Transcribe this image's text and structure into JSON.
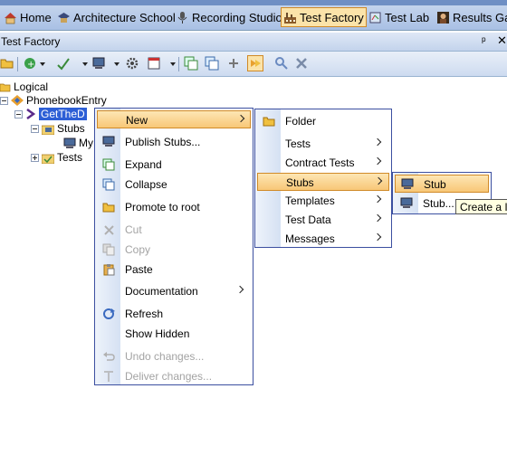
{
  "perspectives": [
    {
      "label": "Home",
      "icon": "house-icon"
    },
    {
      "label": "Architecture School",
      "icon": "graduation-cap-icon"
    },
    {
      "label": "Recording Studio",
      "icon": "microphone-icon"
    },
    {
      "label": "Test Factory",
      "icon": "factory-icon",
      "active": true
    },
    {
      "label": "Test Lab",
      "icon": "test-lab-icon"
    },
    {
      "label": "Results Ga",
      "icon": "results-gallery-icon"
    }
  ],
  "view": {
    "title": "Test Factory",
    "pin_glyph": "ᵖ",
    "close_glyph": "✕"
  },
  "tree": {
    "logical": "Logical",
    "phonebook": "PhonebookEntry",
    "selected": "GetTheD",
    "stubs": "Stubs",
    "my": "My",
    "tests": "Tests"
  },
  "context_menu": {
    "items": [
      {
        "label": "New",
        "icon": "",
        "submenu": true,
        "highlighted": true
      },
      {
        "label": "Publish Stubs...",
        "icon": "computer-icon"
      },
      {
        "label": "Expand",
        "icon": "expand-icon"
      },
      {
        "label": "Collapse",
        "icon": "collapse-icon"
      },
      {
        "label": "Promote to root",
        "icon": "folder-icon"
      },
      {
        "label": "Cut",
        "icon": "scissors-icon",
        "disabled": true
      },
      {
        "label": "Copy",
        "icon": "copy-icon",
        "disabled": true
      },
      {
        "label": "Paste",
        "icon": "paste-icon"
      },
      {
        "label": "Documentation",
        "icon": "",
        "submenu": true
      },
      {
        "label": "Refresh",
        "icon": "refresh-icon"
      },
      {
        "label": "Show Hidden",
        "icon": ""
      },
      {
        "label": "Undo changes...",
        "icon": "undo-icon",
        "disabled": true
      },
      {
        "label": "Deliver changes...",
        "icon": "deliver-icon",
        "disabled": true
      }
    ]
  },
  "new_menu": {
    "items": [
      {
        "label": "Folder",
        "icon": "folder-icon"
      },
      {
        "label": "Tests",
        "submenu": true
      },
      {
        "label": "Contract Tests",
        "submenu": true
      },
      {
        "label": "Stubs",
        "submenu": true,
        "highlighted": true
      },
      {
        "label": "Templates",
        "submenu": true
      },
      {
        "label": "Test Data",
        "submenu": true
      },
      {
        "label": "Messages",
        "submenu": true
      }
    ]
  },
  "stubs_menu": {
    "items": [
      {
        "label": "Stub",
        "icon": "computer-icon",
        "highlighted": true
      },
      {
        "label": "Stub...",
        "icon": "computer-icon"
      }
    ]
  },
  "tooltip": "Create a I"
}
